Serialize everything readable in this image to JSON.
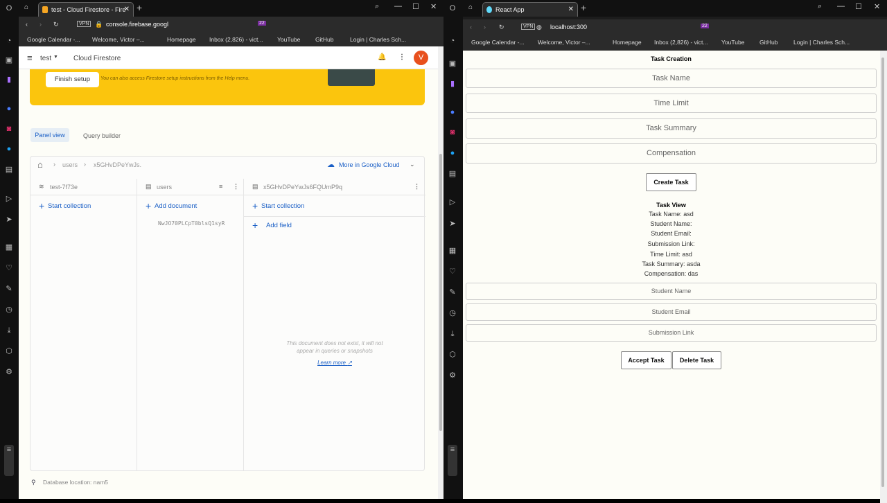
{
  "left_browser": {
    "tab_title": "test - Cloud Firestore - Fire",
    "url": "console.firebase.googl",
    "bookmarks": [
      "Google Calendar -...",
      "Welcome, Victor –...",
      "Homepage",
      "Inbox (2,826) - vict...",
      "YouTube",
      "GitHub",
      "Login | Charles Sch..."
    ],
    "extension_badge": "22",
    "firestore": {
      "project": "test",
      "product": "Cloud Firestore",
      "avatar": "V",
      "finish_setup": "Finish setup",
      "banner_text": "You can also access Firestore setup instructions from the Help menu.",
      "view_tabs": [
        "Panel view",
        "Query builder"
      ],
      "breadcrumb": [
        "users",
        "x5GHvDPeYwJs."
      ],
      "more_cloud": "More in Google Cloud",
      "columns": [
        {
          "header": "test-7f73e",
          "action": "Start collection"
        },
        {
          "header": "users",
          "action": "Add document",
          "items": [
            "NwJO70PLCpT0blsQ1syR"
          ]
        },
        {
          "header": "x5GHvDPeYwJs6FQUmP9q",
          "action": "Start collection",
          "action2": "Add field"
        }
      ],
      "empty_msg_1": "This document does not exist, it will not",
      "empty_msg_2": "appear in queries or snapshots",
      "learn_more": "Learn more",
      "db_location": "Database location: nam5"
    }
  },
  "right_browser": {
    "tab_title": "React App",
    "url": "localhost:300",
    "bookmarks": [
      "Google Calendar -...",
      "Welcome, Victor –...",
      "Homepage",
      "Inbox (2,826) - vict...",
      "YouTube",
      "GitHub",
      "Login | Charles Sch..."
    ],
    "extension_badge": "22",
    "app": {
      "creation_title": "Task Creation",
      "inputs": [
        "Task Name",
        "Time Limit",
        "Task Summary",
        "Compensation"
      ],
      "create_button": "Create Task",
      "view_title": "Task View",
      "view_lines": [
        "Task Name: asd",
        "Student Name:",
        "Student Email:",
        "Submission Link:",
        "Time Limit: asd",
        "Task Summary: asda",
        "Compensation: das"
      ],
      "student_inputs": [
        "Student Name",
        "Student Email",
        "Submission Link"
      ],
      "accept_button": "Accept Task",
      "delete_button": "Delete Task"
    }
  },
  "colors": {
    "banner": "#fbc50d",
    "link": "#1a5fc6",
    "avatar": "#e8501d"
  }
}
